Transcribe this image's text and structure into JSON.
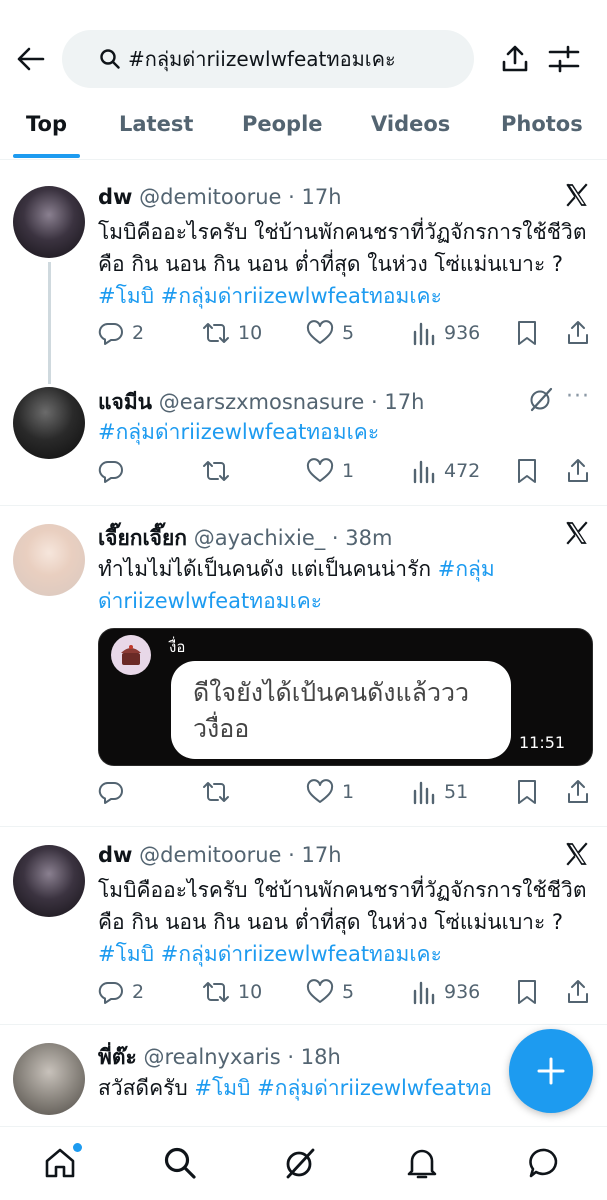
{
  "search": {
    "query": "#กลุ่มด่าriizewlwfeatทอมเคะ"
  },
  "tabs": [
    {
      "label": "Top"
    },
    {
      "label": "Latest"
    },
    {
      "label": "People"
    },
    {
      "label": "Videos"
    },
    {
      "label": "Photos"
    }
  ],
  "posts": [
    {
      "name": "dw",
      "handle": "@demitoorue",
      "time": "17h",
      "text": "โมบิคืออะไรครับ ใช่บ้านพักคนชราที่วัฏจักรการใช้ชีวิตคือ กิน นอน กิน นอน ต่ำที่สุด ในห่วง โซ่แม่นเบาะ ?",
      "tags": [
        "#โมบิ",
        "#กลุ่มด่าriizewlwfeatทอมเคะ"
      ],
      "replies": "2",
      "reposts": "10",
      "likes": "5",
      "views": "936"
    },
    {
      "name": "แจมีน",
      "handle": "@earszxmosnasure",
      "time": "17h",
      "tags": [
        "#กลุ่มด่าriizewlwfeatทอมเคะ"
      ],
      "replies": "",
      "reposts": "",
      "likes": "1",
      "views": "472"
    },
    {
      "name": "เจี๊ยกเจี๊ยก",
      "handle": "@ayachixie_",
      "time": "38m",
      "text": "ทำไมไม่ได้เป็นคนดัง แต่เป็นคนน่ารัก",
      "tag1": "#กลุ่ม",
      "tag2": "ด่าriizewlwfeatทอมเคะ",
      "media": {
        "sender": "งื่อ",
        "message": "ดีใจยังได้เป้นคนดังแล้ววววงื่ออ",
        "time": "11:51"
      },
      "replies": "",
      "reposts": "",
      "likes": "1",
      "views": "51"
    },
    {
      "name": "dw",
      "handle": "@demitoorue",
      "time": "17h",
      "text": "โมบิคืออะไรครับ ใช่บ้านพักคนชราที่วัฏจักรการใช้ชีวิตคือ กิน นอน กิน นอน ต่ำที่สุด ในห่วง โซ่แม่นเบาะ ?",
      "tags": [
        "#โมบิ",
        "#กลุ่มด่าriizewlwfeatทอมเคะ"
      ],
      "replies": "2",
      "reposts": "10",
      "likes": "5",
      "views": "936"
    },
    {
      "name": "พี่ต๊ะ",
      "handle": "@realnyxaris",
      "time": "18h",
      "text": "สวัสดีครับ",
      "tags": [
        "#โมบิ",
        "#กลุ่มด่าriizewlwfeatทอ"
      ]
    }
  ],
  "colors": {
    "accent": "#1d9bf0",
    "text": "#0f1419",
    "muted": "#536471"
  }
}
